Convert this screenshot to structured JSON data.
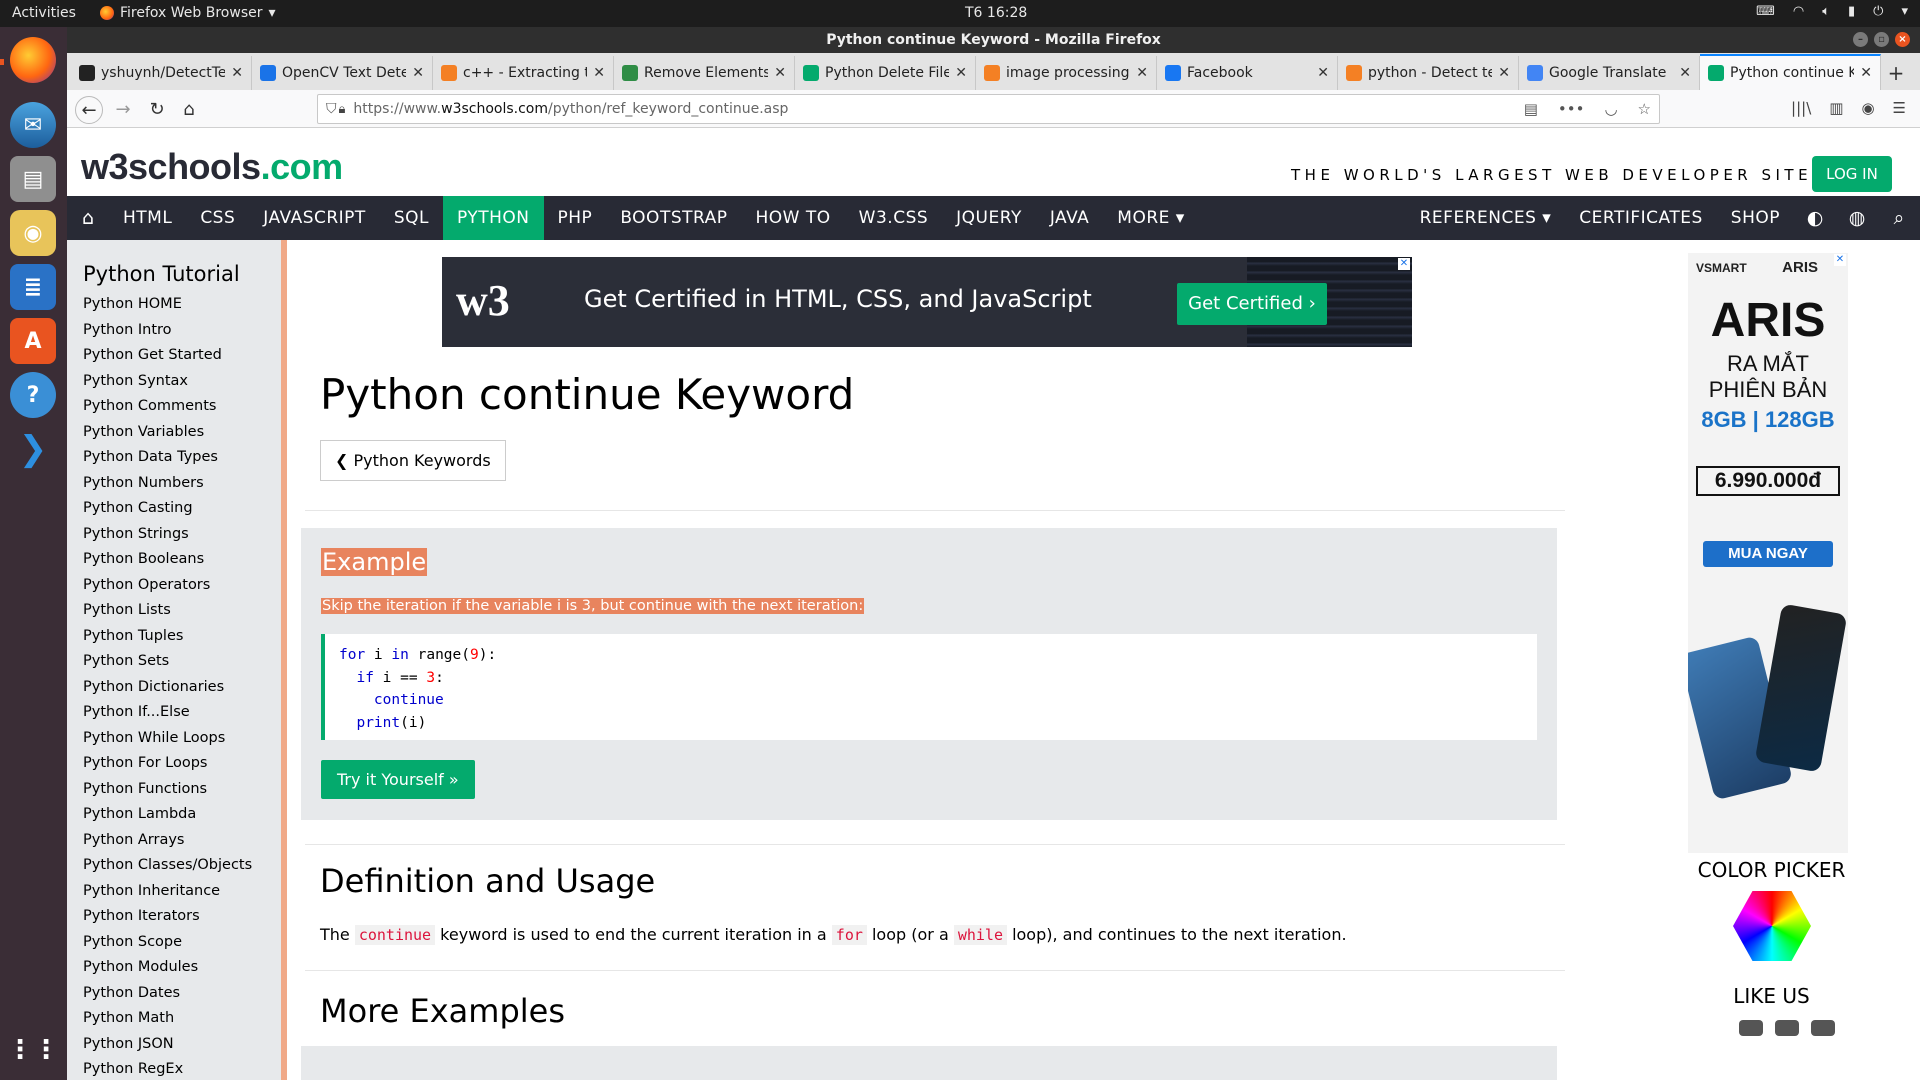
{
  "system_bar": {
    "activities": "Activities",
    "app_menu": "Firefox Web Browser",
    "clock": "T6 16:28"
  },
  "window": {
    "title": "Python continue Keyword - Mozilla Firefox"
  },
  "tabs": [
    {
      "label": "yshuynh/DetectTe",
      "favicon": "github-icon",
      "color": "#222222"
    },
    {
      "label": "OpenCV Text Dete",
      "favicon": "pyimagesearch-icon",
      "color": "#1a73e8"
    },
    {
      "label": "c++ - Extracting te",
      "favicon": "stackoverflow-icon",
      "color": "#f48024"
    },
    {
      "label": "Remove Elements",
      "favicon": "gfg-icon",
      "color": "#2f8d46"
    },
    {
      "label": "Python Delete File",
      "favicon": "w3schools-icon",
      "color": "#04aa6d"
    },
    {
      "label": "image processing",
      "favicon": "stackoverflow-icon",
      "color": "#f48024"
    },
    {
      "label": "Facebook",
      "favicon": "facebook-icon",
      "color": "#1877f2"
    },
    {
      "label": "python - Detect te",
      "favicon": "stackoverflow-icon",
      "color": "#f48024"
    },
    {
      "label": "Google Translate",
      "favicon": "google-translate-icon",
      "color": "#4285f4"
    },
    {
      "label": "Python continue K",
      "favicon": "w3schools-icon",
      "color": "#04aa6d",
      "active": true
    }
  ],
  "url": {
    "prefix": "https://www.",
    "host": "w3schools.com",
    "path": "/python/ref_keyword_continue.asp"
  },
  "site": {
    "logo_main": "w3schools",
    "logo_dotcom": ".com",
    "tagline": "THE WORLD'S LARGEST WEB DEVELOPER SITE",
    "login": "LOG IN",
    "accent_color": "#04aa6d"
  },
  "topnav": [
    "HTML",
    "CSS",
    "JAVASCRIPT",
    "SQL",
    "PYTHON",
    "PHP",
    "BOOTSTRAP",
    "HOW TO",
    "W3.CSS",
    "JQUERY",
    "JAVA",
    "MORE ▾"
  ],
  "topnav_right": [
    "REFERENCES ▾",
    "CERTIFICATES",
    "SHOP"
  ],
  "sidebar": {
    "title": "Python Tutorial",
    "items": [
      "Python HOME",
      "Python Intro",
      "Python Get Started",
      "Python Syntax",
      "Python Comments",
      "Python Variables",
      "Python Data Types",
      "Python Numbers",
      "Python Casting",
      "Python Strings",
      "Python Booleans",
      "Python Operators",
      "Python Lists",
      "Python Tuples",
      "Python Sets",
      "Python Dictionaries",
      "Python If...Else",
      "Python While Loops",
      "Python For Loops",
      "Python Functions",
      "Python Lambda",
      "Python Arrays",
      "Python Classes/Objects",
      "Python Inheritance",
      "Python Iterators",
      "Python Scope",
      "Python Modules",
      "Python Dates",
      "Python Math",
      "Python JSON",
      "Python RegEx"
    ]
  },
  "banner": {
    "logo": "w3",
    "text": "Get Certified in HTML, CSS, and JavaScript",
    "button": "Get Certified ›"
  },
  "main": {
    "title": "Python continue Keyword",
    "back_button": "❮ Python Keywords",
    "example_heading": "Example",
    "example_desc": "Skip the iteration if the variable i is 3, but continue with the next iteration:",
    "try_button": "Try it Yourself »",
    "definition_heading": "Definition and Usage",
    "definition_parts": {
      "p1": "The ",
      "code1": "continue",
      "p2": " keyword is used to end the current iteration in a ",
      "code2": "for",
      "p3": " loop (or a ",
      "code3": "while",
      "p4": " loop), and continues to the next iteration."
    },
    "more_heading": "More Examples"
  },
  "code": {
    "l1_kw1": "for",
    "l1_a": " i ",
    "l1_kw2": "in",
    "l1_fn": " range",
    "l1_p1": "(",
    "l1_num": "9",
    "l1_p2": "):",
    "l2_indent": "  ",
    "l2_kw": "if",
    "l2_a": " i == ",
    "l2_num": "3",
    "l2_b": ":",
    "l3_indent": "    ",
    "l3_kw": "continue",
    "l4_indent": "  ",
    "l4_fn": "print",
    "l4_rest": "(i)"
  },
  "ad": {
    "brand": "VSMART",
    "model": "ARIS",
    "title": "ARIS",
    "subtitle_1": "RA MẮT",
    "subtitle_2": "PHIÊN BẢN",
    "spec": "8GB | 128GB",
    "price": "6.990.000đ",
    "cta": "MUA NGAY"
  },
  "right_column": {
    "color_picker": "COLOR PICKER",
    "like_us": "LIKE US"
  }
}
